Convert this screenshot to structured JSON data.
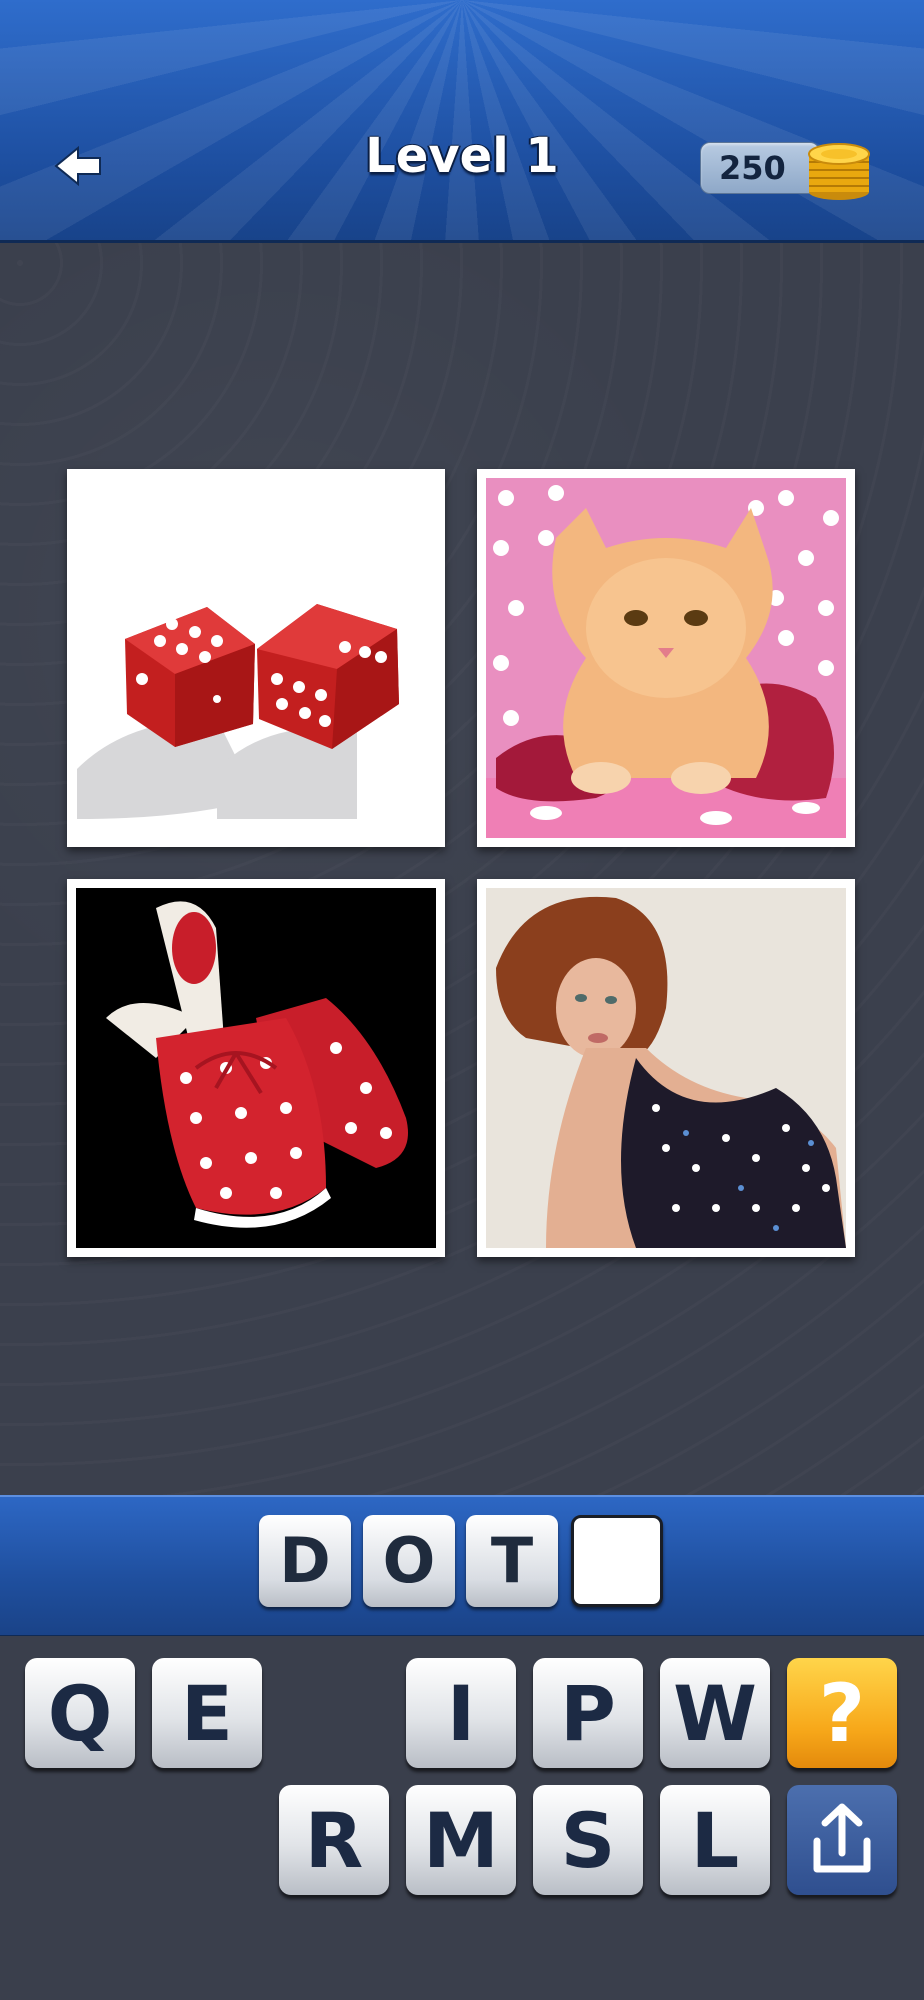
{
  "header": {
    "title": "Level 1",
    "coins": "250",
    "back_icon": "back-arrow-icon",
    "coin_icon": "gold-coins-icon"
  },
  "puzzle": {
    "images": [
      {
        "name": "red polka-dot dice"
      },
      {
        "name": "kitten on polka-dot background"
      },
      {
        "name": "polka-dot slippers"
      },
      {
        "name": "woman in polka-dot dress"
      }
    ]
  },
  "answer": {
    "slots": [
      "D",
      "O",
      "T",
      ""
    ]
  },
  "keyboard": {
    "row1": [
      "Q",
      "E",
      "I",
      "P",
      "W"
    ],
    "row2": [
      "R",
      "M",
      "S",
      "L"
    ],
    "hint_label": "?",
    "share_icon": "share-icon"
  },
  "colors": {
    "header_blue": "#1d4e9f",
    "background": "#3b404d",
    "hint_orange": "#f7a81a",
    "share_blue": "#2f4f8f"
  }
}
